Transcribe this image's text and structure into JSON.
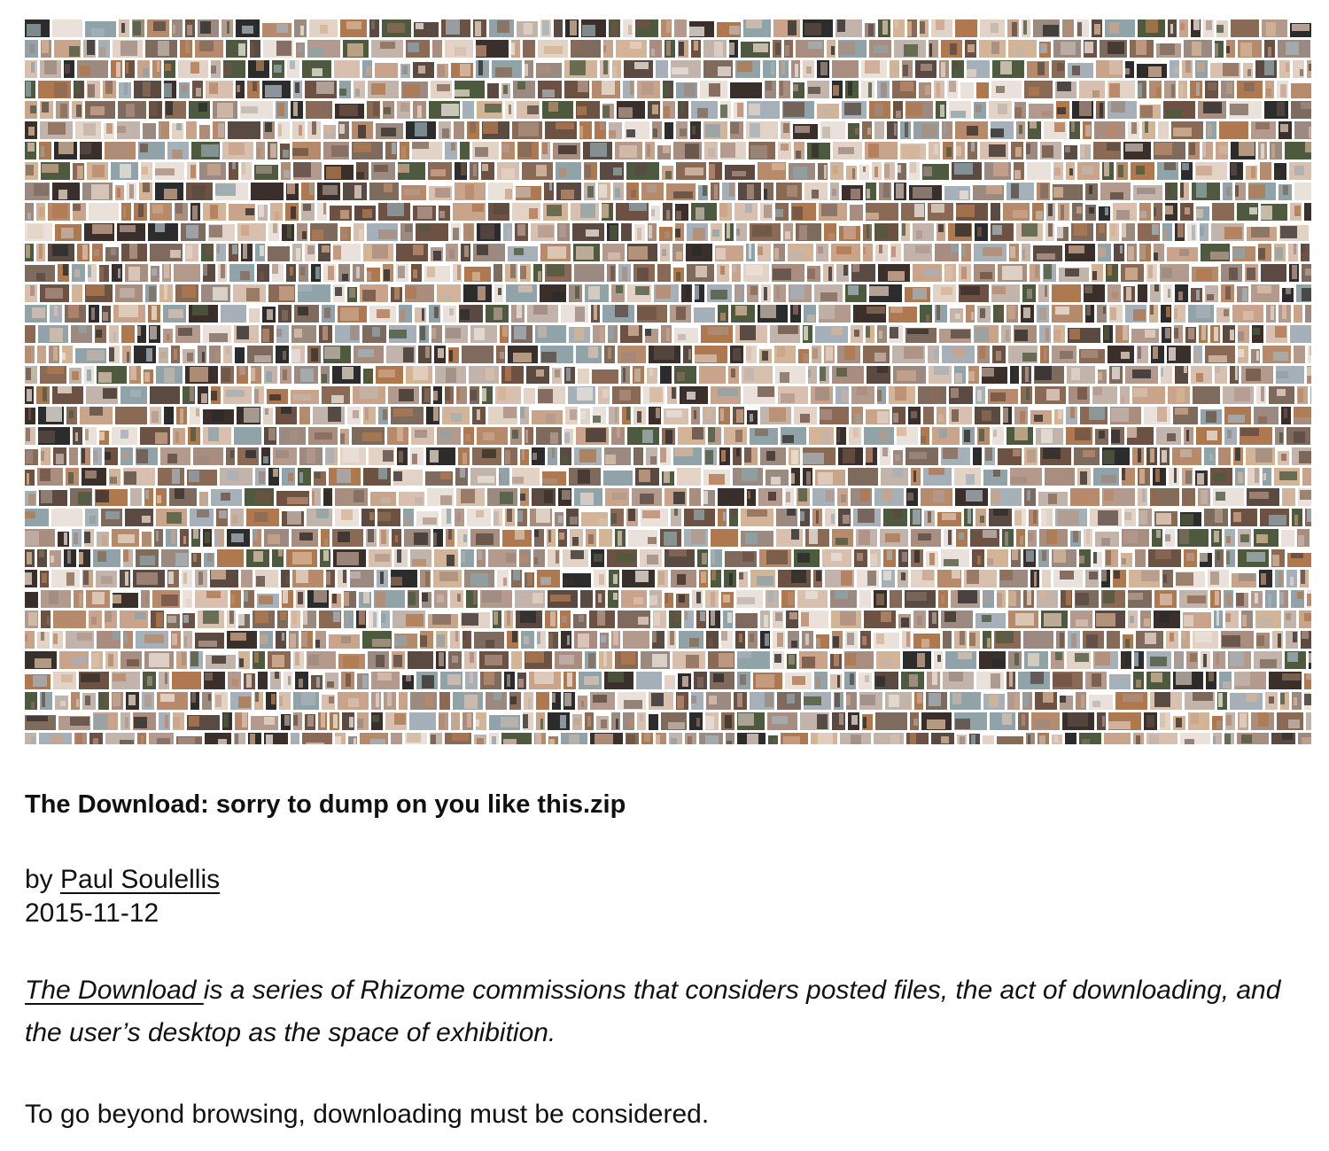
{
  "article": {
    "title": "The Download: sorry to dump on you like this.zip",
    "byline_prefix": "by",
    "author": "Paul Soulellis",
    "date": "2015-11-12",
    "intro_link": "The Download ",
    "intro_rest": "is a series of Rhizome commissions that considers posted files, the act of downloading, and the user’s desktop as the space of exhibition.",
    "body_first": "To go beyond browsing, downloading must be considered."
  },
  "mosaic": {
    "palette": [
      "#c9a48a",
      "#b88a6c",
      "#8a6a55",
      "#d8bfae",
      "#6d5244",
      "#a98d7e",
      "#e3d3c6",
      "#5a4a42",
      "#9c8a80",
      "#c2b4aa",
      "#7f6a5e",
      "#3a2f2b",
      "#b39a8c",
      "#d4b496",
      "#8fa3a8",
      "#e9e1da",
      "#4d5a3e",
      "#a5b0b8",
      "#b0784f",
      "#2c2c2c"
    ]
  }
}
